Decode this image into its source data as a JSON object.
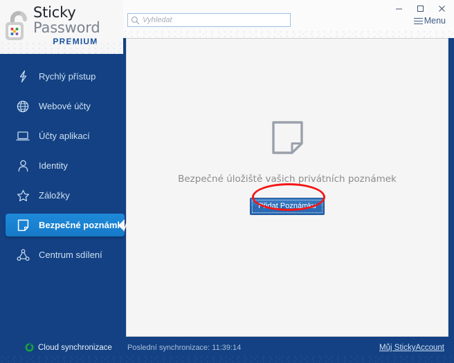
{
  "window": {
    "minimize_label": "–",
    "maximize_label": "☐",
    "close_label": "✕",
    "menu_label": "Menu"
  },
  "brand": {
    "line1": "Sticky",
    "line2": "Password",
    "line3": "PREMIUM",
    "lock_icon": "open-padlock-icon"
  },
  "search": {
    "placeholder": "Vyhledat",
    "value": "",
    "icon": "search-icon"
  },
  "sidebar": {
    "items": [
      {
        "label": "Rychlý přístup",
        "icon": "lightning-bolt-icon",
        "active": false
      },
      {
        "label": "Webové účty",
        "icon": "globe-icon",
        "active": false
      },
      {
        "label": "Účty aplikací",
        "icon": "laptop-icon",
        "active": false
      },
      {
        "label": "Identity",
        "icon": "person-icon",
        "active": false
      },
      {
        "label": "Záložky",
        "icon": "star-icon",
        "active": false
      },
      {
        "label": "Bezpečné poznámky",
        "icon": "note-icon",
        "active": true
      },
      {
        "label": "Centrum sdílení",
        "icon": "share-network-icon",
        "active": false
      }
    ]
  },
  "main": {
    "empty_state": {
      "icon": "note-page-icon",
      "message": "Bezpečné úložiště vašich privátních poznámek",
      "button_label": "Přidat Poznámku"
    },
    "annotation": {
      "shape": "red-ellipse-highlight",
      "color": "#f41616"
    }
  },
  "footer": {
    "sync_label": "Cloud synchronizace",
    "sync_icon": "cloud-sync-icon",
    "last_sync": "Poslední synchronizace: 11:39:14",
    "account_link": "Můj StickyAccount"
  },
  "colors": {
    "sidebar_bg": "#134183",
    "active_item": "#1b84d4",
    "panel_bg": "#f5f5f5",
    "accent_red": "#f41616",
    "button_blue": "#2f6fb8"
  }
}
